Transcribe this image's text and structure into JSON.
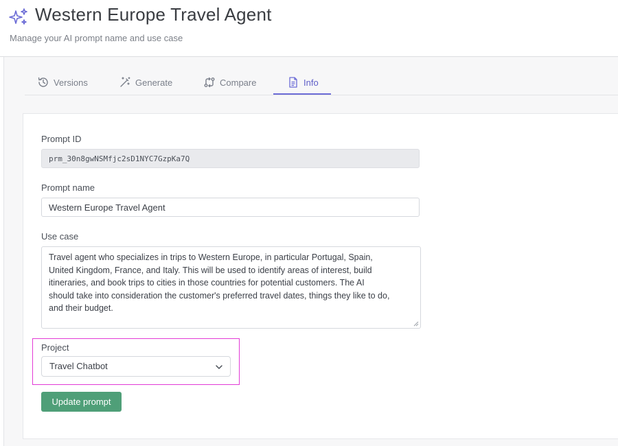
{
  "header": {
    "title": "Western Europe Travel Agent",
    "subtitle": "Manage your AI prompt name and use case",
    "icon": "sparkles-icon"
  },
  "tabs": [
    {
      "label": "Versions",
      "icon": "history-icon",
      "active": false
    },
    {
      "label": "Generate",
      "icon": "magic-wand-icon",
      "active": false
    },
    {
      "label": "Compare",
      "icon": "compare-arrows-icon",
      "active": false
    },
    {
      "label": "Info",
      "icon": "document-icon",
      "active": true
    }
  ],
  "form": {
    "prompt_id_label": "Prompt ID",
    "prompt_id_value": "prm_30n8gwNSMfjc2sD1NYC7GzpKa7Q",
    "prompt_name_label": "Prompt name",
    "prompt_name_value": "Western Europe Travel Agent",
    "use_case_label": "Use case",
    "use_case_lines": [
      "Travel agent who specializes in trips to Western Europe, in particular Portugal, Spain,",
      "United Kingdom, France, and Italy. This will be used to identify areas of interest, build",
      "itineraries, and book trips to cities in those countries for potential customers. The AI",
      "should take into consideration the customer's preferred travel dates, things they like to do,",
      "and their budget."
    ],
    "project_label": "Project",
    "project_value": "Travel Chatbot",
    "submit_label": "Update prompt"
  },
  "colors": {
    "accent": "#6b6bd6",
    "button": "#4f9f78",
    "highlight": "#e23ad6"
  }
}
